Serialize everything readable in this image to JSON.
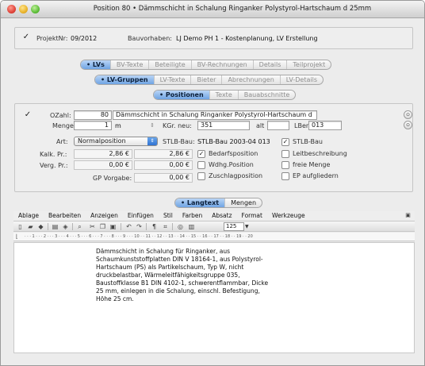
{
  "window": {
    "title": "Position 80 • Dämmschicht in Schalung Ringanker Polystyrol-Hartschaum d 25mm"
  },
  "project": {
    "checked": "✓",
    "projektnr_label": "ProjektNr:",
    "projektnr_value": "09/2012",
    "bauvorhaben_label": "Bauvorhaben:",
    "bauvorhaben_value": "LJ Demo PH 1 - Kostenplanung, LV Erstellung"
  },
  "tabs_level1": [
    "• LVs",
    "BV-Texte",
    "Beteiligte",
    "BV-Rechnungen",
    "Details",
    "Teilprojekt"
  ],
  "tabs_level2": [
    "• LV-Gruppen",
    "LV-Texte",
    "Bieter",
    "Abrechnungen",
    "LV-Details"
  ],
  "tabs_level3": [
    "• Positionen",
    "Texte",
    "Bauabschnitte"
  ],
  "position": {
    "checked": "✓",
    "ozahl_label": "OZahl:",
    "ozahl_value": "80",
    "kurztext_value": "Dämmschicht in Schalung Ringanker Polystyrol-Hartschaum d",
    "menge_label": "Menge",
    "menge_value": "1",
    "einheit_value": "m",
    "kgr_label": "KGr. neu:",
    "kgr_value": "351",
    "alt_label": "alt",
    "alt_value": "",
    "lber_label": "LBer.",
    "lber_value": "013",
    "art_label": "Art:",
    "art_value": "Normalposition",
    "stlb_label": "STLB-Bau:",
    "stlb_value": "STLB-Bau  2003-04 013",
    "stlb_check_label": "STLB-Bau",
    "kalk_label": "Kalk. Pr.:",
    "kalk_value1": "2,86 €",
    "kalk_value2": "2,86 €",
    "verg_label": "Verg. Pr.:",
    "verg_value1": "0,00 €",
    "verg_value2": "0,00 €",
    "gp_label": "GP Vorgabe:",
    "gp_value": "0,00 €",
    "options": [
      {
        "label": "Bedarfsposition",
        "checked": "✓"
      },
      {
        "label": "Wdhg.Position",
        "checked": ""
      },
      {
        "label": "Zuschlagposition",
        "checked": ""
      },
      {
        "label": "Leitbeschreibung",
        "checked": ""
      },
      {
        "label": "freie Menge",
        "checked": ""
      },
      {
        "label": "EP aufgliedern",
        "checked": ""
      }
    ]
  },
  "text_tabs": [
    "• Langtext",
    "Mengen"
  ],
  "menu": [
    "Ablage",
    "Bearbeiten",
    "Anzeigen",
    "Einfügen",
    "Stil",
    "Farben",
    "Absatz",
    "Format",
    "Werkzeuge"
  ],
  "toolbar": {
    "zoom_value": "125"
  },
  "ruler_text": "· · · 1 · · · 2 · · · 3 · · · 4 · · · 5 · · · 6 · · · 7 · · · 8 · · · 9 · · · 10 · · 11 · · 12 · · 13 · · 14 · · 15 · · 16 · · 17 · · 18 · · 19 · · 20",
  "langtext": "Dämmschicht in Schalung für Ringanker, aus\nSchaumkunststoffplatten DIN V 18164-1, aus Polystyrol-\nHartschaum (PS) als Partikelschaum, Typ W, nicht\ndruckbelastbar, Wärmeleitfähigkeitsgruppe 035,\nBaustoffklasse B1 DIN 4102-1, schwerentflammbar, Dicke\n25 mm, einlegen in die Schalung, einschl. Befestigung,\nHöhe 25 cm."
}
